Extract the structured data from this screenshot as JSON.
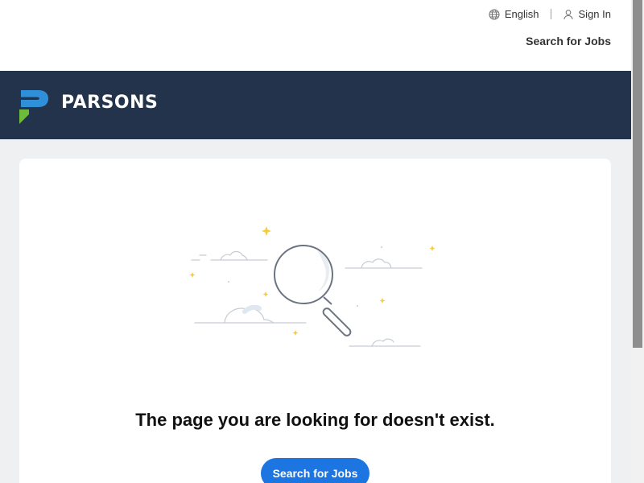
{
  "header": {
    "language_label": "English",
    "sign_in_label": "Sign In",
    "search_jobs_label": "Search for Jobs"
  },
  "brand": {
    "name": "PARSONS",
    "colors": {
      "bar": "#22334b",
      "logo_blue": "#2f8fd8",
      "logo_green": "#6dbb3b"
    }
  },
  "error": {
    "message": "The page you are looking for doesn't exist.",
    "cta_label": "Search for Jobs",
    "illustration": "magnifying-glass-clouds-illustration"
  },
  "icons": {
    "language": "globe-icon",
    "sign_in": "user-icon"
  },
  "colors": {
    "accent": "#1c75e0",
    "page_bg": "#eff0f1"
  }
}
